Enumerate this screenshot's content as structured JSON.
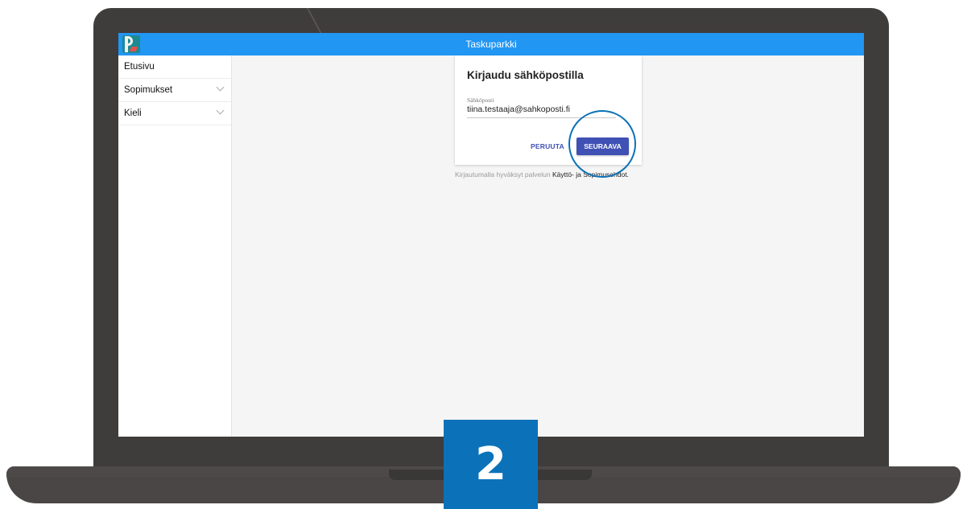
{
  "app": {
    "title": "Taskuparkki",
    "logo_letter": "P"
  },
  "sidebar": {
    "items": [
      {
        "label": "Etusivu",
        "has_chevron": false
      },
      {
        "label": "Sopimukset",
        "has_chevron": true
      },
      {
        "label": "Kieli",
        "has_chevron": true
      }
    ]
  },
  "login": {
    "title": "Kirjaudu sähköpostilla",
    "email_label": "Sähköposti",
    "email_value": "tiina.testaaja@sahkoposti.fi",
    "cancel_label": "PERUUTA",
    "next_label": "SEURAAVA"
  },
  "terms": {
    "prefix": "Kirjautumalla hyväksyt palvelun ",
    "link": "Käyttö- ja Sopimusehdot."
  },
  "step": {
    "number": "2"
  },
  "colors": {
    "appbar": "#2196f3",
    "primary_button": "#3f51b5",
    "highlight": "#0b72b9",
    "laptop": "#3f3c3c"
  }
}
